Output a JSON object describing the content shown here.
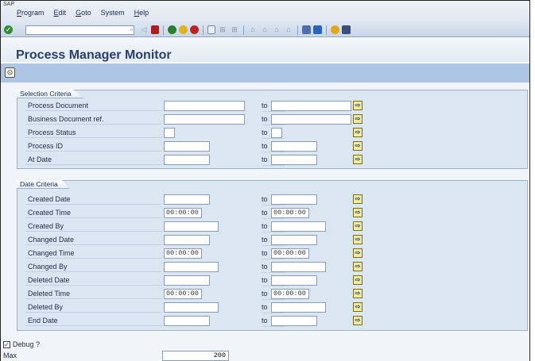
{
  "menu": {
    "sap_mark": "SAP",
    "items": [
      {
        "label": "Program",
        "u": "P",
        "rest": "rogram"
      },
      {
        "label": "Edit",
        "u": "E",
        "rest": "dit"
      },
      {
        "label": "Goto",
        "u": "G",
        "rest": "oto"
      },
      {
        "label": "System",
        "u": "",
        "rest": "System"
      },
      {
        "label": "Help",
        "u": "H",
        "rest": "elp"
      }
    ]
  },
  "toolbar": {
    "command_field_value": "",
    "icons": [
      "enter-icon",
      "back-icon",
      "save-icon",
      "green-circle-icon",
      "yellow-circle-icon",
      "cancel-icon",
      "print-icon",
      "find-icon",
      "find-next-icon",
      "first-page-icon",
      "prev-page-icon",
      "next-page-icon",
      "last-page-icon",
      "new-session-icon",
      "shortcut-icon",
      "help-icon",
      "layout-icon"
    ]
  },
  "page": {
    "title": "Process Manager Monitor"
  },
  "selection_criteria": {
    "title": "Selection Criteria",
    "to_label": "to",
    "rows": [
      {
        "label": "Process Document",
        "from": "",
        "to": ""
      },
      {
        "label": "Business Document ref.",
        "from": "",
        "to": ""
      },
      {
        "label": "Process Status",
        "from": "",
        "to": ""
      },
      {
        "label": "Process ID",
        "from": "",
        "to": ""
      },
      {
        "label": "At Date",
        "from": "",
        "to": ""
      }
    ]
  },
  "date_criteria": {
    "title": "Date Criteria",
    "to_label": "to",
    "rows": [
      {
        "label": "Created Date",
        "from": "",
        "to": ""
      },
      {
        "label": "Created Time",
        "from": "00:00:00",
        "to": "00:00:00"
      },
      {
        "label": "Created By",
        "from": "",
        "to": ""
      },
      {
        "label": "Changed Date",
        "from": "",
        "to": ""
      },
      {
        "label": "Changed Time",
        "from": "00:00:00",
        "to": "00:00:00"
      },
      {
        "label": "Changed By",
        "from": "",
        "to": ""
      },
      {
        "label": "Deleted Date",
        "from": "",
        "to": ""
      },
      {
        "label": "Deleted Time",
        "from": "00:00:00",
        "to": "00:00:00"
      },
      {
        "label": "Deleted By",
        "from": "",
        "to": ""
      },
      {
        "label": "End Date",
        "from": "",
        "to": ""
      }
    ]
  },
  "options": {
    "debug_label": "Debug ?",
    "debug_checked": true,
    "max_rows_label": "Max Rows",
    "max_rows_value": "200"
  }
}
